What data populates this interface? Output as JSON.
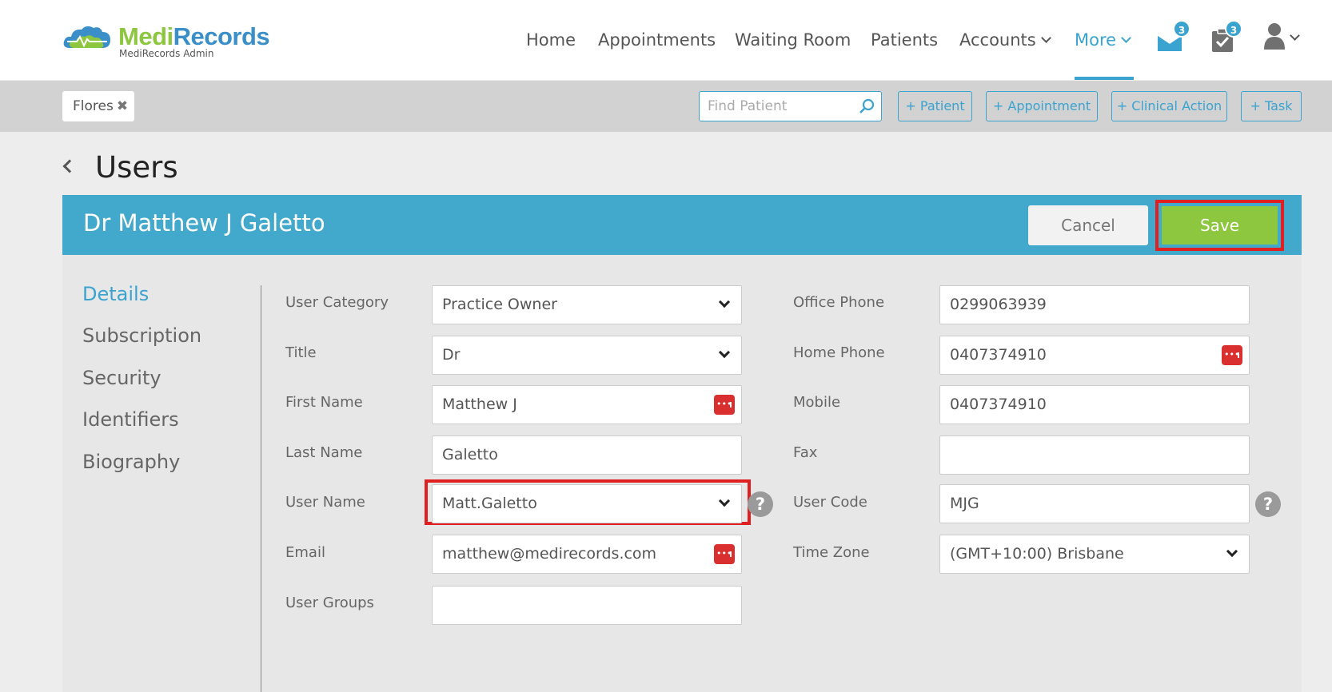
{
  "brand": {
    "name_part1": "Medi",
    "name_part2": "Records",
    "subtitle": "MediRecords Admin"
  },
  "nav": {
    "items": [
      {
        "label": "Home"
      },
      {
        "label": "Appointments"
      },
      {
        "label": "Waiting Room"
      },
      {
        "label": "Patients"
      },
      {
        "label": "Accounts"
      },
      {
        "label": "More"
      }
    ],
    "mail_badge": "3",
    "tasks_badge": "3",
    "accent": "#3aa3cf"
  },
  "toolbar": {
    "patient_tab": "Flores",
    "close_glyph": "✖",
    "find_placeholder": "Find Patient",
    "buttons": [
      "+ Patient",
      "+ Appointment",
      "+ Clinical Action",
      "+ Task"
    ]
  },
  "page": {
    "title": "Users"
  },
  "header": {
    "doctor_name": "Dr Matthew J Galetto",
    "cancel_label": "Cancel",
    "save_label": "Save"
  },
  "sidenav": {
    "items": [
      "Details",
      "Subscription",
      "Security",
      "Identifiers",
      "Biography"
    ]
  },
  "form": {
    "left": [
      {
        "label": "User Category",
        "value": "Practice Owner"
      },
      {
        "label": "Title",
        "value": "Dr"
      },
      {
        "label": "First Name",
        "value": "Matthew J"
      },
      {
        "label": "Last Name",
        "value": "Galetto"
      },
      {
        "label": "User Name",
        "value": "Matt.Galetto"
      },
      {
        "label": "Email",
        "value": "matthew@medirecords.com"
      },
      {
        "label": "User Groups",
        "value": ""
      }
    ],
    "right": [
      {
        "label": "Office Phone",
        "value": "0299063939"
      },
      {
        "label": "Home Phone",
        "value": "0407374910"
      },
      {
        "label": "Mobile",
        "value": "0407374910"
      },
      {
        "label": "Fax",
        "value": ""
      },
      {
        "label": "User Code",
        "value": "MJG"
      },
      {
        "label": "Time Zone",
        "value": "(GMT+10:00) Brisbane"
      }
    ],
    "help_glyph": "?"
  },
  "colors": {
    "header_blue": "#42a8cc",
    "save_green": "#8dc63f",
    "highlight_red": "#e02020"
  }
}
